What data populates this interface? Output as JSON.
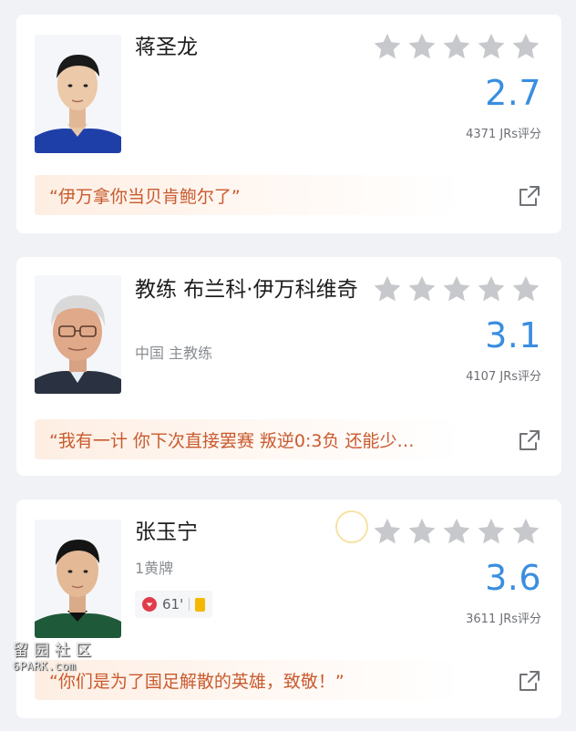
{
  "players": [
    {
      "name": "蒋圣龙",
      "subtitle": "",
      "score": "2.7",
      "rating_count": "4371 JRs评分",
      "quote": "“伊万拿你当贝肯鲍尔了”",
      "stars_total": 5,
      "avatar": "player-portrait-blue-jersey"
    },
    {
      "name": "教练 布兰科·伊万科维奇",
      "subtitle": "中国 主教练",
      "score": "3.1",
      "rating_count": "4107 JRs评分",
      "quote": "“我有一计 你下次直接罢赛 叛逆0:3负 还能少…",
      "stars_total": 5,
      "avatar": "coach-portrait-glasses"
    },
    {
      "name": "张玉宁",
      "subtitle": "1黄牌",
      "score": "3.6",
      "rating_count": "3611 JRs评分",
      "quote": "“你们是为了国足解散的英雄，致敬！”",
      "stars_total": 5,
      "avatar": "player-portrait-green-jersey",
      "event": {
        "minute": "61'",
        "sub_icon": "substitution-off-icon",
        "card_icon": "yellow-card-icon"
      }
    }
  ],
  "colors": {
    "score": "#3a8ee0",
    "quote_text": "#c95a2e",
    "star": "#c6c8cc",
    "yellow_card": "#f5b800"
  },
  "watermark": {
    "line1": "留园社区",
    "line2": "6PARK.com"
  }
}
